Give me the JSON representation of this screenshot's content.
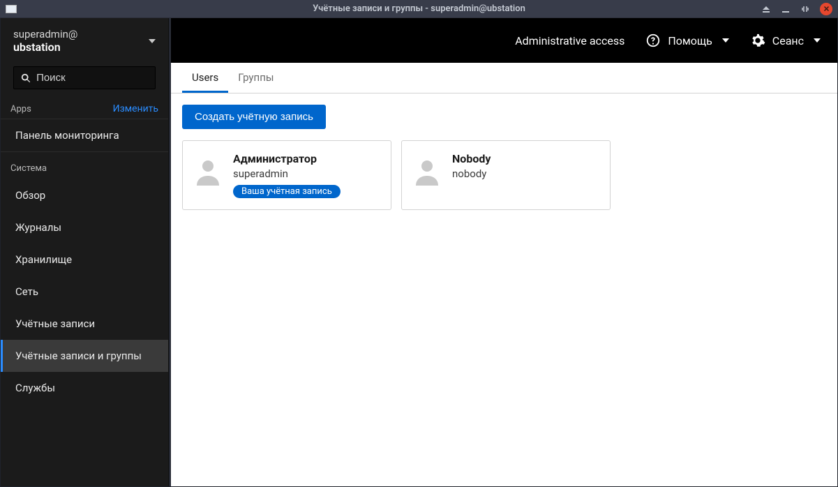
{
  "window": {
    "title": "Учётные записи и группы - superadmin@ubstation"
  },
  "sidebar": {
    "user": "superadmin@",
    "host": "ubstation",
    "search_placeholder": "Поиск",
    "apps_header": "Apps",
    "edit_label": "Изменить",
    "dashboard_label": "Панель мониторинга",
    "system_header": "Система",
    "items": [
      {
        "label": "Обзор"
      },
      {
        "label": "Журналы"
      },
      {
        "label": "Хранилище"
      },
      {
        "label": "Сеть"
      },
      {
        "label": "Учётные записи"
      },
      {
        "label": "Учётные записи и группы"
      },
      {
        "label": "Службы"
      }
    ]
  },
  "topbar": {
    "admin_access": "Administrative access",
    "help_label": "Помощь",
    "session_label": "Сеанс"
  },
  "tabs": [
    {
      "label": "Users",
      "active": true
    },
    {
      "label": "Группы",
      "active": false
    }
  ],
  "create_button": "Создать учётную запись",
  "users": [
    {
      "display": "Администратор",
      "login": "superadmin",
      "badge": "Ваша учётная запись"
    },
    {
      "display": "Nobody",
      "login": "nobody",
      "badge": null
    }
  ]
}
